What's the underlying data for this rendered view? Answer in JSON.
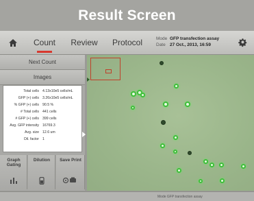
{
  "banner": {
    "title": "Result Screen"
  },
  "topbar": {
    "tabs": [
      {
        "label": "Count",
        "active": true
      },
      {
        "label": "Review",
        "active": false
      },
      {
        "label": "Protocol",
        "active": false
      }
    ],
    "mode_label": "Mode",
    "mode_value": "GFP transfection assay",
    "date_label": "Date",
    "date_value": "27 Oct., 2013, 16:59"
  },
  "sidebar": {
    "next_count": "Next Count",
    "images": "Images",
    "results": [
      {
        "label": "Total cells",
        "value": "4.13x10e5 cells/mL"
      },
      {
        "label": "GFP (+) cells",
        "value": "3.26x10e5 cells/mL"
      },
      {
        "label": "% GFP (+) cells",
        "value": "90.5 %"
      },
      {
        "label": "# Total cells",
        "value": "441 cells"
      },
      {
        "label": "# GFP (+) cells",
        "value": "399 cells"
      },
      {
        "label": "Avg. GFP intensity",
        "value": "16769.3"
      },
      {
        "label": "Avg. size",
        "value": "12.6 um"
      },
      {
        "label": "Dil. factor",
        "value": "1"
      }
    ],
    "tools": [
      {
        "label": "Graph Gating",
        "icon": "bar-chart-icon"
      },
      {
        "label": "Dilution",
        "icon": "tube-icon"
      },
      {
        "label": "Save Print",
        "icon": "save-print-icon"
      }
    ]
  },
  "bottombar": {
    "mode_text": "Mode  GFP transfection assay"
  },
  "colors": {
    "accent": "#d8382e",
    "gfp_cell": "#3fbe3a",
    "field_bg": "#9fb88f"
  }
}
